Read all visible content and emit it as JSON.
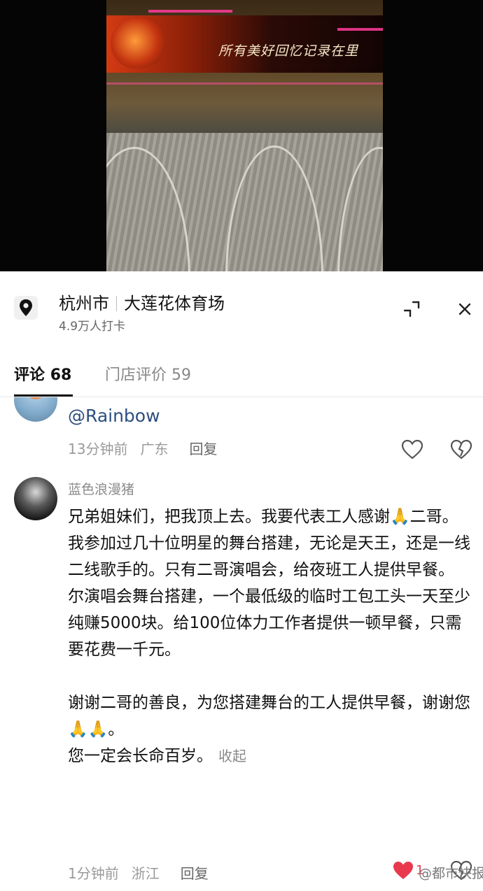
{
  "video": {
    "screen_text": "所有美好回忆记录在里"
  },
  "location": {
    "city": "杭州市",
    "venue": "大莲花体育场",
    "checkins": "4.9万人打卡",
    "icon": "location-pin-icon"
  },
  "header": {
    "expand_icon": "collapse-expand-icon",
    "close_icon": "close-icon"
  },
  "tabs": [
    {
      "label": "评论",
      "count": "68",
      "active": true
    },
    {
      "label": "门店评价",
      "count": "59",
      "active": false
    }
  ],
  "comments": [
    {
      "author": "",
      "mention": "@Rainbow",
      "time": "13分钟前",
      "region": "广东",
      "reply_label": "回复"
    },
    {
      "author": "蓝色浪漫猪",
      "paragraphs": [
        "兄弟姐妹们，把我顶上去。我要代表工人感谢🙏二哥。",
        "我参加过几十位明星的舞台搭建，无论是天王，还是一线二线歌手的。只有二哥演唱会，给夜班工人提供早餐。",
        "尔演唱会舞台搭建，一个最低级的临时工包工头一天至少纯赚5000块。给100位体力工作者提供一顿早餐，只需要花费一千元。",
        "",
        "谢谢二哥的善良，为您搭建舞台的工人提供早餐，谢谢您🙏🙏。",
        "您一定会长命百岁。"
      ],
      "collapse_label": "收起",
      "time": "1分钟前",
      "region": "浙江",
      "reply_label": "回复",
      "likes": "1"
    }
  ],
  "watermark": "@都市快报",
  "colors": {
    "accent_like": "#e8394f",
    "mention": "#2c4f80"
  }
}
